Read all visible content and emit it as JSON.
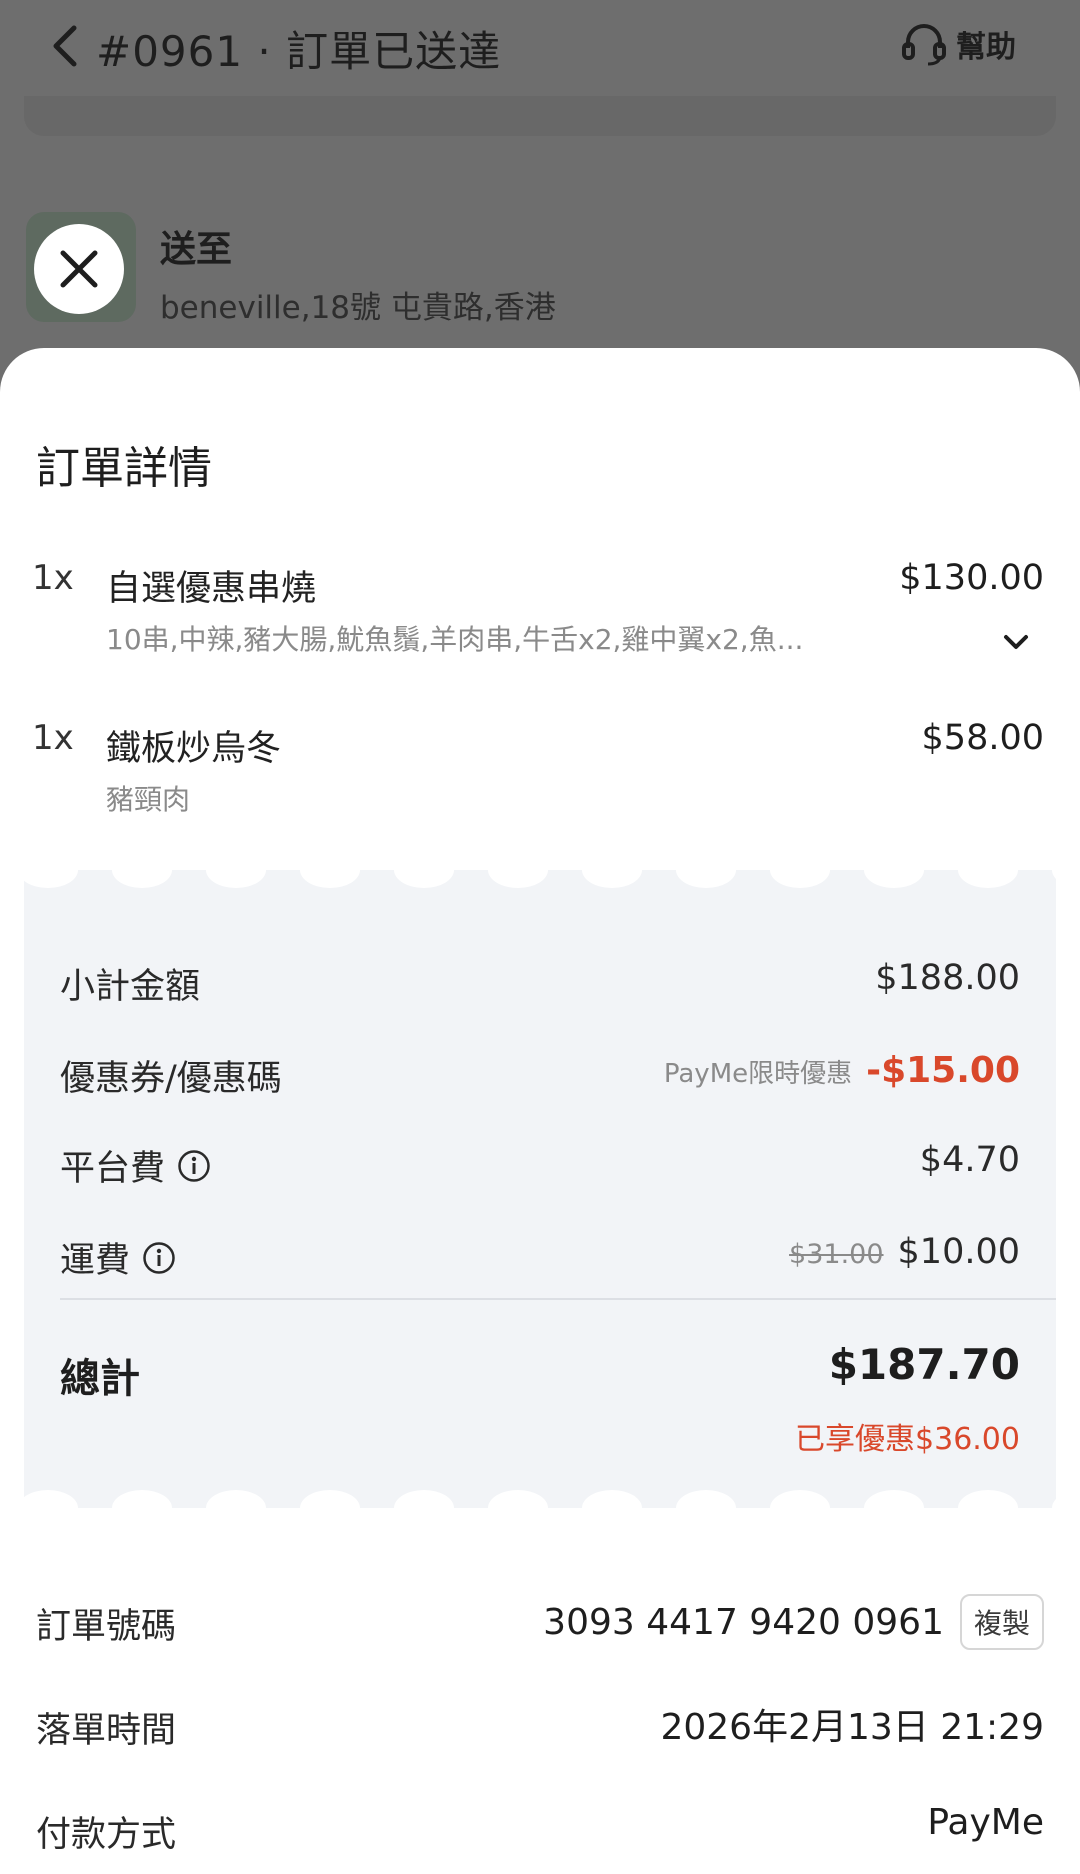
{
  "header": {
    "title": "#0961 · 訂單已送達",
    "help_label": "幫助"
  },
  "delivery": {
    "label": "送至",
    "address": "beneville,18號 屯貴路,香港"
  },
  "sheet": {
    "title": "訂單詳情"
  },
  "items": [
    {
      "qty": "1x",
      "name": "自選優惠串燒",
      "price": "$130.00",
      "desc": "10串,中辣,豬大腸,魷魚鬚,羊肉串,牛舌x2,雞中翼x2,魚..."
    },
    {
      "qty": "1x",
      "name": "鐵板炒烏冬",
      "price": "$58.00",
      "desc": "豬頸肉"
    }
  ],
  "summary": {
    "subtotal_label": "小計金額",
    "subtotal_value": "$188.00",
    "coupon_label": "優惠券/優惠碼",
    "coupon_tag": "PayMe限時優惠",
    "coupon_value": "-$15.00",
    "platform_fee_label": "平台費",
    "platform_fee_value": "$4.70",
    "delivery_fee_label": "運費",
    "delivery_fee_original": "$31.00",
    "delivery_fee_value": "$10.00",
    "total_label": "總計",
    "total_value": "$187.70",
    "saved_text": "已享優惠$36.00"
  },
  "order_info": {
    "order_no_label": "訂單號碼",
    "order_no_value": "3093 4417 9420 0961",
    "copy_label": "複製",
    "time_label": "落單時間",
    "time_value": "2026年2月13日 21:29",
    "payment_label": "付款方式",
    "payment_value": "PayMe"
  },
  "colors": {
    "discount": "#d9482b",
    "receipt_bg": "#f2f4f7",
    "overlay": "#6e6e6e"
  }
}
